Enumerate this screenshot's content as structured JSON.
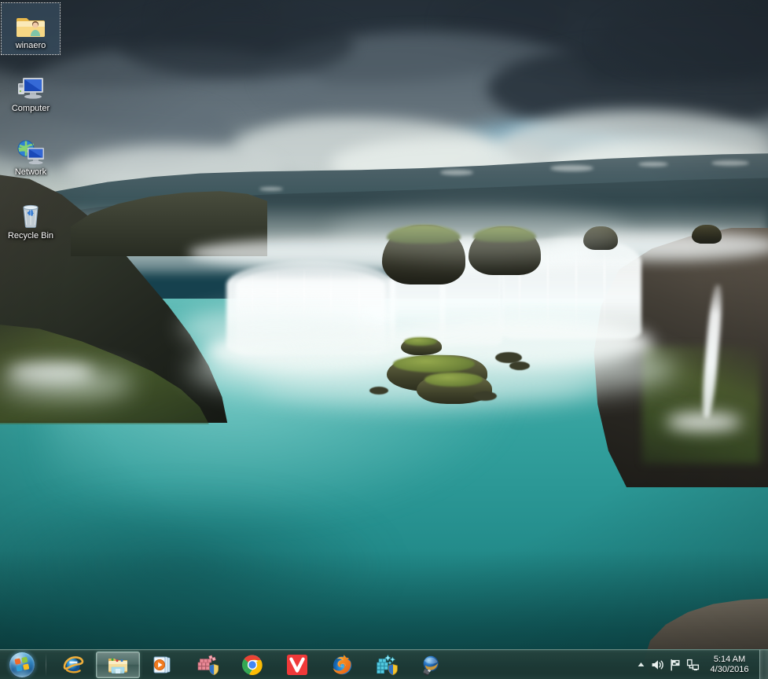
{
  "desktop": {
    "wallpaper_name": "Godafoss waterfall",
    "icons": [
      {
        "label": "winaero",
        "icon": "user-folder-icon",
        "selected": true
      },
      {
        "label": "Computer",
        "icon": "computer-icon",
        "selected": false
      },
      {
        "label": "Network",
        "icon": "network-icon",
        "selected": false
      },
      {
        "label": "Recycle Bin",
        "icon": "recycle-bin-icon",
        "selected": false
      }
    ]
  },
  "taskbar": {
    "start_button": {
      "label": "Start",
      "icon": "windows-start-orb-icon"
    },
    "buttons": [
      {
        "label": "Internet Explorer",
        "icon": "internet-explorer-icon",
        "active": false
      },
      {
        "label": "Windows Explorer",
        "icon": "windows-explorer-icon",
        "active": true
      },
      {
        "label": "Windows Media Player",
        "icon": "media-player-icon",
        "active": false
      },
      {
        "label": "Disk Defragmenter",
        "icon": "defragmenter-icon",
        "active": false
      },
      {
        "label": "Google Chrome",
        "icon": "chrome-icon",
        "active": false
      },
      {
        "label": "Vivaldi",
        "icon": "vivaldi-icon",
        "active": false
      },
      {
        "label": "Mozilla Firefox",
        "icon": "firefox-icon",
        "active": false
      },
      {
        "label": "Disk Cleanup",
        "icon": "disk-cleanup-icon",
        "active": false
      },
      {
        "label": "Winaero Tweaker",
        "icon": "winaero-tweaker-icon",
        "active": false
      }
    ],
    "tray": {
      "show_hidden_icons": {
        "label": "Show hidden icons",
        "icon": "chevron-up-icon"
      },
      "volume": {
        "label": "Volume",
        "icon": "speaker-icon"
      },
      "action_center": {
        "label": "Action Center",
        "icon": "flag-icon"
      },
      "network": {
        "label": "Network",
        "icon": "network-monitor-icon"
      }
    },
    "clock": {
      "time": "5:14 AM",
      "date": "4/30/2016"
    },
    "show_desktop": {
      "label": "Show desktop"
    }
  },
  "colors": {
    "taskbar": "#1e3a36",
    "taskbar_border": "#a8d2c8",
    "water_light": "#63bdb8",
    "water_dark": "#14696a",
    "sky_dark": "#2e3c48",
    "sky_blue_patch": "#78c3e8",
    "icon_text": "#ffffff"
  }
}
